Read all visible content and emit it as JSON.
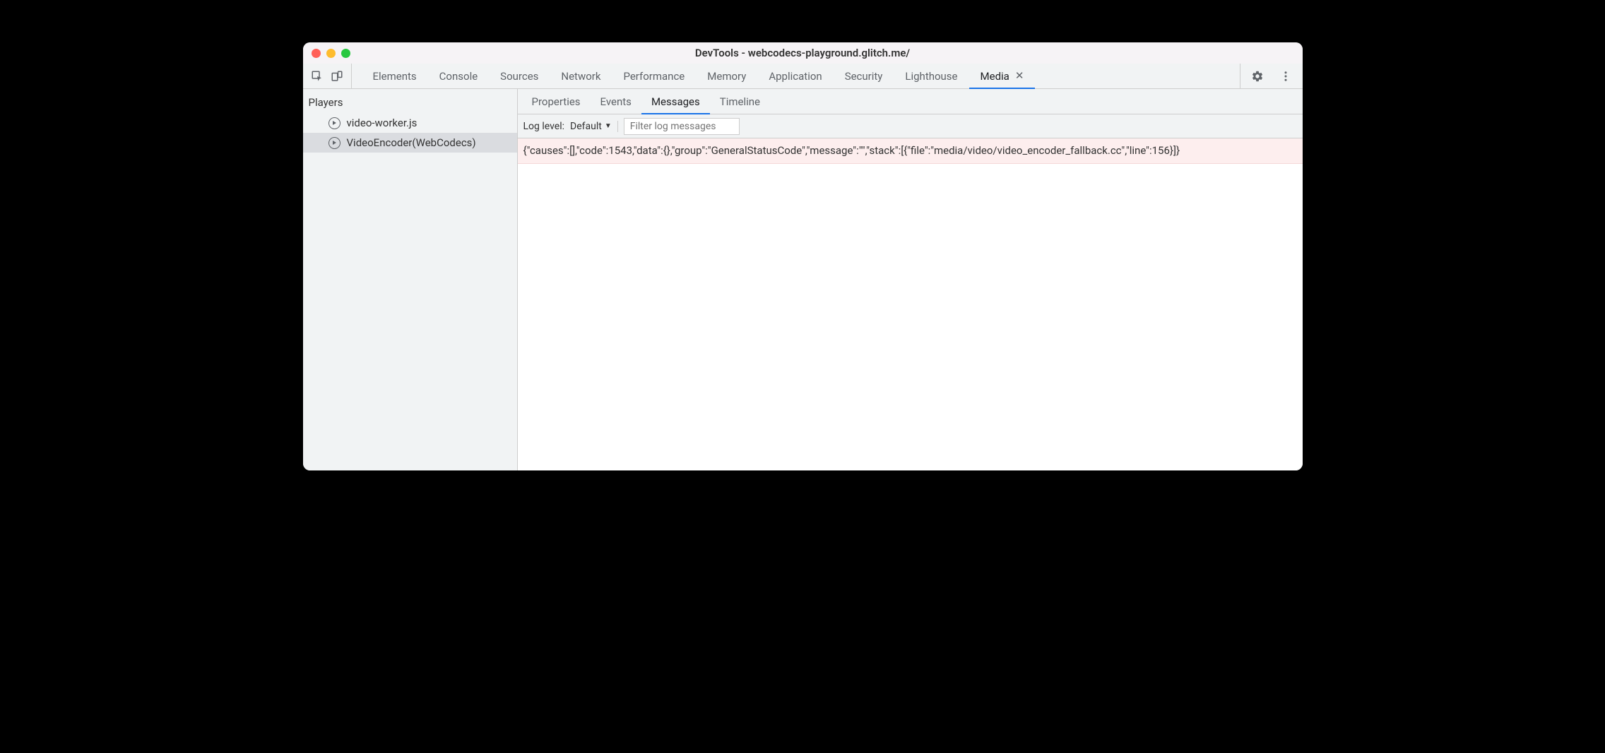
{
  "window": {
    "title": "DevTools - webcodecs-playground.glitch.me/"
  },
  "toolbar": {
    "tabs": [
      {
        "label": "Elements",
        "active": false,
        "closable": false
      },
      {
        "label": "Console",
        "active": false,
        "closable": false
      },
      {
        "label": "Sources",
        "active": false,
        "closable": false
      },
      {
        "label": "Network",
        "active": false,
        "closable": false
      },
      {
        "label": "Performance",
        "active": false,
        "closable": false
      },
      {
        "label": "Memory",
        "active": false,
        "closable": false
      },
      {
        "label": "Application",
        "active": false,
        "closable": false
      },
      {
        "label": "Security",
        "active": false,
        "closable": false
      },
      {
        "label": "Lighthouse",
        "active": false,
        "closable": false
      },
      {
        "label": "Media",
        "active": true,
        "closable": true
      }
    ]
  },
  "sidebar": {
    "header": "Players",
    "items": [
      {
        "label": "video-worker.js",
        "selected": false
      },
      {
        "label": "VideoEncoder(WebCodecs)",
        "selected": true
      }
    ]
  },
  "subtabs": [
    {
      "label": "Properties",
      "active": false
    },
    {
      "label": "Events",
      "active": false
    },
    {
      "label": "Messages",
      "active": true
    },
    {
      "label": "Timeline",
      "active": false
    }
  ],
  "filter": {
    "log_level_label": "Log level:",
    "log_level_value": "Default",
    "input_placeholder": "Filter log messages"
  },
  "messages": [
    {
      "text": "{\"causes\":[],\"code\":1543,\"data\":{},\"group\":\"GeneralStatusCode\",\"message\":\"\",\"stack\":[{\"file\":\"media/video/video_encoder_fallback.cc\",\"line\":156}]}",
      "level": "error"
    }
  ]
}
